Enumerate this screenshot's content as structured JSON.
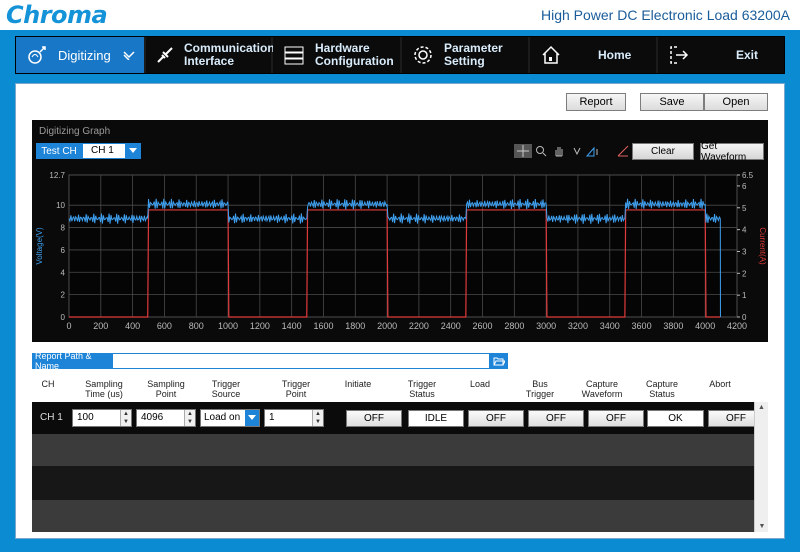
{
  "header": {
    "logo": "Chroma",
    "title": "High Power DC Electronic Load 63200A"
  },
  "nav": {
    "items": [
      {
        "label": "Digitizing",
        "icon": "digitizing-icon",
        "active": true
      },
      {
        "label": "Communication\nInterface",
        "icon": "usb-plug-icon"
      },
      {
        "label": "Hardware\nConfiguration",
        "icon": "server-stack-icon"
      },
      {
        "label": "Parameter\nSetting",
        "icon": "gear-icon"
      },
      {
        "label": "Home",
        "icon": "home-icon"
      },
      {
        "label": "Exit",
        "icon": "exit-icon"
      }
    ]
  },
  "actions": {
    "report": "Report",
    "save": "Save",
    "open": "Open"
  },
  "graph": {
    "title": "Digitizing Graph",
    "test_ch_label": "Test CH",
    "channel_value": "CH 1",
    "clear_label": "Clear",
    "get_waveform_label": "Get Waveform",
    "toolbar_icons": [
      "crosshair-icon",
      "zoom-icon",
      "pan-hand-icon",
      "v-cursor-icon",
      "h-cursor-icon",
      "slope-icon"
    ],
    "colors": {
      "voltage": "#3fa0f0",
      "current": "#e03a3a",
      "background": "#0a0a0a",
      "grid": "#4a4a4a"
    }
  },
  "chart_data": {
    "type": "line",
    "title": "",
    "xlabel": "",
    "ylabel": "Voltage(V)",
    "y2label": "Current(A)",
    "xlim": [
      0,
      4200
    ],
    "ylim": [
      0,
      12.7
    ],
    "y2lim": [
      0,
      6.5
    ],
    "x_ticks": [
      0,
      200,
      400,
      600,
      800,
      1000,
      1200,
      1400,
      1600,
      1800,
      2000,
      2200,
      2400,
      2600,
      2800,
      3000,
      3200,
      3400,
      3600,
      3800,
      4000,
      4200
    ],
    "y_ticks": [
      0,
      2,
      4,
      6,
      8,
      10,
      12.7
    ],
    "y_tick_labels": [
      "0",
      "2",
      "4",
      "6",
      "8",
      "10",
      "12.7"
    ],
    "y2_ticks": [
      0,
      1,
      2,
      3,
      4,
      5,
      6,
      6.5
    ],
    "grid": true,
    "series": [
      {
        "name": "Voltage(V)",
        "axis": "left",
        "points": [
          [
            0,
            8.8
          ],
          [
            495,
            8.8
          ],
          [
            500,
            10.1
          ],
          [
            1000,
            10.1
          ],
          [
            1005,
            8.8
          ],
          [
            1495,
            8.8
          ],
          [
            1500,
            10.1
          ],
          [
            2000,
            10.1
          ],
          [
            2005,
            8.8
          ],
          [
            2495,
            8.8
          ],
          [
            2500,
            10.1
          ],
          [
            3000,
            10.1
          ],
          [
            3005,
            8.8
          ],
          [
            3495,
            8.8
          ],
          [
            3500,
            10.1
          ],
          [
            4000,
            10.1
          ],
          [
            4005,
            8.8
          ],
          [
            4095,
            8.8
          ],
          [
            4096,
            0
          ]
        ]
      },
      {
        "name": "Current(A)",
        "axis": "right",
        "points": [
          [
            0,
            0
          ],
          [
            495,
            0
          ],
          [
            500,
            4.9
          ],
          [
            1000,
            4.9
          ],
          [
            1005,
            0
          ],
          [
            1495,
            0
          ],
          [
            1500,
            4.9
          ],
          [
            2000,
            4.9
          ],
          [
            2005,
            0
          ],
          [
            2495,
            0
          ],
          [
            2500,
            4.9
          ],
          [
            3000,
            4.9
          ],
          [
            3005,
            0
          ],
          [
            3495,
            0
          ],
          [
            3500,
            4.9
          ],
          [
            4000,
            4.9
          ],
          [
            4005,
            0
          ],
          [
            4095,
            0
          ]
        ]
      }
    ]
  },
  "report": {
    "label": "Report Path & Name",
    "value": ""
  },
  "table": {
    "headers": [
      "CH",
      "Sampling\nTime (us)",
      "Sampling\nPoint",
      "Trigger\nSource",
      "Trigger\nPoint",
      "Initiate",
      "Trigger\nStatus",
      "Load",
      "Bus\nTrigger",
      "Capture\nWaveform",
      "Capture\nStatus",
      "Abort"
    ],
    "rows": [
      {
        "ch": "CH 1",
        "sampling_time": "100",
        "sampling_point": "4096",
        "trigger_source": "Load on",
        "trigger_point": "1",
        "initiate": "OFF",
        "trigger_status": "IDLE",
        "load": "OFF",
        "bus_trigger": "OFF",
        "capture_waveform": "OFF",
        "capture_status": "OK",
        "abort": "OFF"
      }
    ]
  }
}
